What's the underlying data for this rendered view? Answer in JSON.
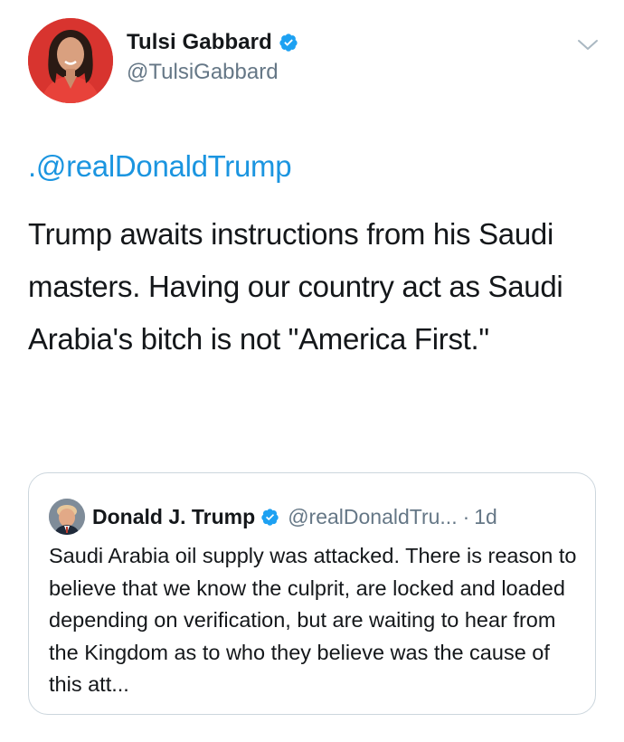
{
  "tweet": {
    "author": {
      "display_name": "Tulsi Gabbard",
      "handle": "@TulsiGabbard",
      "verified": true,
      "avatar_icon": "profile-photo"
    },
    "menu_icon": "chevron-down-icon",
    "mention": ".@realDonaldTrump",
    "text": "Trump awaits instructions from his Saudi masters. Having our country act as Saudi Arabia's bitch is not \"America First.\""
  },
  "quoted_tweet": {
    "author": {
      "display_name": "Donald J. Trump",
      "handle": "@realDonaldTru...",
      "verified": true,
      "avatar_icon": "profile-photo"
    },
    "separator": "·",
    "time": "1d",
    "text": "Saudi Arabia oil supply was attacked. There is reason to believe that we know the culprit, are locked and loaded depending on verification, but are waiting to hear from the Kingdom as to who they believe was the cause of this att..."
  },
  "colors": {
    "link_blue": "#1b95e0",
    "verified_blue": "#1da1f2",
    "secondary_text": "#657786",
    "primary_text": "#14171a",
    "card_border": "#ccd6dd"
  }
}
